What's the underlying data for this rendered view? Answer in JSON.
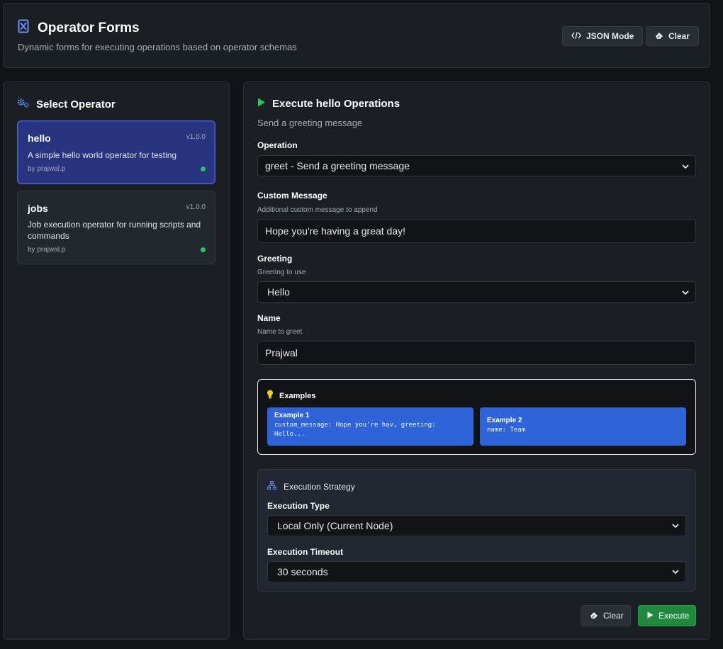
{
  "header": {
    "title": "Operator Forms",
    "subtitle": "Dynamic forms for executing operations based on operator schemas",
    "logo_icon": "cube-icon",
    "json_mode_label": "JSON Mode",
    "clear_label": "Clear"
  },
  "sidebar": {
    "title": "Select Operator",
    "title_icon": "cogs-icon",
    "operators": [
      {
        "name": "hello",
        "version": "v1.0.0",
        "description": "A simple hello world operator for testing",
        "author": "by prajwal.p",
        "selected": true
      },
      {
        "name": "jobs",
        "version": "v1.0.0",
        "description": "Job execution operator for running scripts and commands",
        "author": "by prajwal.p",
        "selected": false
      }
    ]
  },
  "main": {
    "title": "Execute hello Operations",
    "title_icon": "play-icon",
    "subtitle": "Send a greeting message",
    "operation": {
      "label": "Operation",
      "value": "greet - Send a greeting message"
    },
    "custom_message": {
      "label": "Custom Message",
      "hint": "Additional custom message to append",
      "value": "Hope you're having a great day!"
    },
    "greeting": {
      "label": "Greeting",
      "hint": "Greeting to use",
      "value": "Hello"
    },
    "name": {
      "label": "Name",
      "hint": "Name to greet",
      "value": "Prajwal"
    },
    "examples": {
      "title": "Examples",
      "icon": "lightbulb-icon",
      "items": [
        {
          "title": "Example 1",
          "line1": "custom_message: Hope you're hav, greeting:",
          "line2": "Hello..."
        },
        {
          "title": "Example 2",
          "line1": "name: Team",
          "line2": ""
        }
      ]
    },
    "strategy": {
      "title": "Execution Strategy",
      "icon": "network-icon",
      "type_label": "Execution Type",
      "type_value": "Local Only (Current Node)",
      "timeout_label": "Execution Timeout",
      "timeout_value": "30 seconds"
    },
    "clear_label": "Clear",
    "execute_label": "Execute"
  },
  "colors": {
    "background": "#111317",
    "panel": "#1b1e23",
    "accent_blue": "#2f63d9",
    "selected_card": "#283480",
    "execute_green": "#1f8a3f",
    "status_dot": "#22c55e"
  }
}
